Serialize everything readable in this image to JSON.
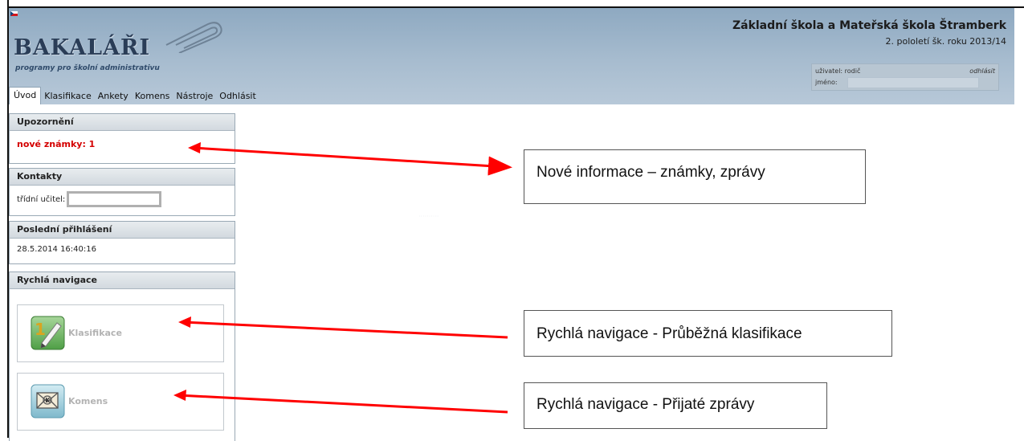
{
  "header": {
    "logo": "BAKALÁŘI",
    "logo_subtitle": "programy pro školní administrativu",
    "school_name": "Základní škola a Mateřská škola Štramberk",
    "term": "2. pololetí šk. roku 2013/14",
    "user_label": "uživatel: rodič",
    "logout_label": "odhlásit",
    "name_label": "jméno:",
    "flag_icon": "czech-flag-icon",
    "decor_icon": "paperclip-icon"
  },
  "tabs": [
    "Úvod",
    "Klasifikace",
    "Ankety",
    "Komens",
    "Nástroje",
    "Odhlásit"
  ],
  "panels": {
    "alerts": {
      "title": "Upozornění",
      "text": "nové známky: 1"
    },
    "contacts": {
      "title": "Kontakty",
      "teacher_label": "třídní učitel:"
    },
    "last_login": {
      "title": "Poslední přihlášení",
      "value": "28.5.2014 16:40:16"
    },
    "quick_nav": {
      "title": "Rychlá navigace",
      "items": [
        {
          "label": "Klasifikace",
          "icon": "grade-pencil-icon"
        },
        {
          "label": "Komens",
          "icon": "envelope-icon"
        }
      ]
    }
  },
  "callouts": [
    "Nové informace – známky, zprávy",
    "Rychlá navigace - Průběžná klasifikace",
    "Rychlá navigace - Přijaté zprávy"
  ],
  "colors": {
    "alert": "#d40000",
    "arrow": "#ff0000",
    "header": "#a7bccf"
  }
}
